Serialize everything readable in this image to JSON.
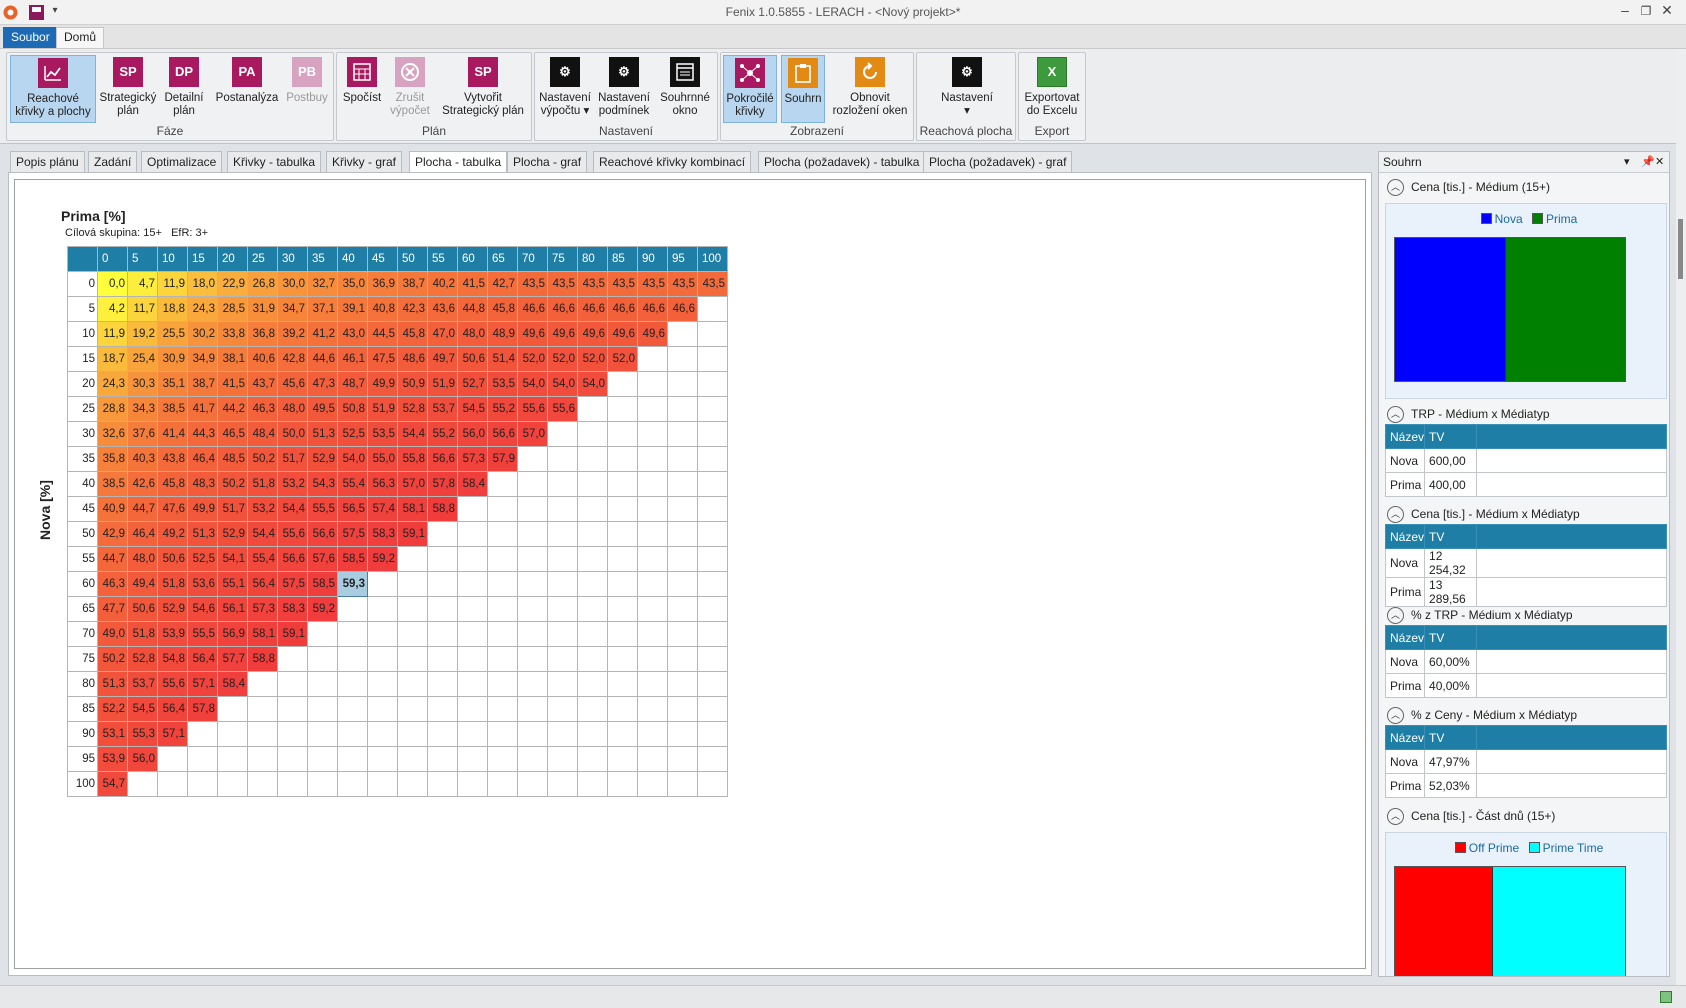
{
  "window": {
    "title": "Fenix 1.0.5855 - LERACH - <Nový projekt>*"
  },
  "menu_tabs": {
    "soubor": "Soubor",
    "domu": "Domů"
  },
  "ribbon": {
    "groups": {
      "faze": "Fáze",
      "plan": "Plán",
      "nastaveni": "Nastavení",
      "zobrazeni": "Zobrazení",
      "reachova": "Reachová plocha",
      "export": "Export"
    },
    "buttons": [
      {
        "label": "Reachové křivky a plochy",
        "icon": "chart-icon",
        "text": ""
      },
      {
        "label": "Strategický plán",
        "icon": "sp-icon",
        "text": "SP"
      },
      {
        "label": "Detailní plán",
        "icon": "dp-icon",
        "text": "DP"
      },
      {
        "label": "Postanalýza",
        "icon": "pa-icon",
        "text": "PA"
      },
      {
        "label": "Postbuy",
        "icon": "pb-icon",
        "text": "PB"
      },
      {
        "label": "Spočíst",
        "icon": "calculator-icon",
        "text": ""
      },
      {
        "label": "Zrušit výpočet",
        "icon": "cancel-icon",
        "text": ""
      },
      {
        "label": "Vytvořit Strategický plán",
        "icon": "sp-create-icon",
        "text": "SP"
      },
      {
        "label": "Nastavení výpočtu",
        "icon": "gear-icon",
        "text": ""
      },
      {
        "label": "Nastavení podmínek",
        "icon": "gear-icon",
        "text": ""
      },
      {
        "label": "Souhrnné okno",
        "icon": "window-icon",
        "text": ""
      },
      {
        "label": "Pokročilé křivky",
        "icon": "network-icon",
        "text": ""
      },
      {
        "label": "Souhrn",
        "icon": "clipboard-icon",
        "text": ""
      },
      {
        "label": "Obnovit rozložení oken",
        "icon": "refresh-icon",
        "text": ""
      },
      {
        "label": "Nastavení",
        "icon": "gear-icon",
        "text": ""
      },
      {
        "label": "Exportovat do Excelu",
        "icon": "excel-icon",
        "text": "X"
      }
    ]
  },
  "doc_tabs": [
    "Popis plánu",
    "Zadání",
    "Optimalizace",
    "Křivky - tabulka",
    "Křivky - graf",
    "Plocha - tabulka",
    "Plocha - graf",
    "Reachové křivky kombinací",
    "Plocha (požadavek) - tabulka",
    "Plocha (požadavek) - graf"
  ],
  "grid": {
    "title": "Prima [%]",
    "subtitle": "Cílová skupina: 15+   EfR: 3+",
    "ylabel": "Nova [%]",
    "columns": [
      "0",
      "5",
      "10",
      "15",
      "20",
      "25",
      "30",
      "35",
      "40",
      "45",
      "50",
      "55",
      "60",
      "65",
      "70",
      "75",
      "80",
      "85",
      "90",
      "95",
      "100"
    ],
    "rows": [
      {
        "h": "0",
        "v": [
          "0,0",
          "4,7",
          "11,9",
          "18,0",
          "22,9",
          "26,8",
          "30,0",
          "32,7",
          "35,0",
          "36,9",
          "38,7",
          "40,2",
          "41,5",
          "42,7",
          "43,5",
          "43,5",
          "43,5",
          "43,5",
          "43,5",
          "43,5",
          "43,5"
        ]
      },
      {
        "h": "5",
        "v": [
          "4,2",
          "11,7",
          "18,8",
          "24,3",
          "28,5",
          "31,9",
          "34,7",
          "37,1",
          "39,1",
          "40,8",
          "42,3",
          "43,6",
          "44,8",
          "45,8",
          "46,6",
          "46,6",
          "46,6",
          "46,6",
          "46,6",
          "46,6"
        ]
      },
      {
        "h": "10",
        "v": [
          "11,9",
          "19,2",
          "25,5",
          "30,2",
          "33,8",
          "36,8",
          "39,2",
          "41,2",
          "43,0",
          "44,5",
          "45,8",
          "47,0",
          "48,0",
          "48,9",
          "49,6",
          "49,6",
          "49,6",
          "49,6",
          "49,6"
        ]
      },
      {
        "h": "15",
        "v": [
          "18,7",
          "25,4",
          "30,9",
          "34,9",
          "38,1",
          "40,6",
          "42,8",
          "44,6",
          "46,1",
          "47,5",
          "48,6",
          "49,7",
          "50,6",
          "51,4",
          "52,0",
          "52,0",
          "52,0",
          "52,0"
        ]
      },
      {
        "h": "20",
        "v": [
          "24,3",
          "30,3",
          "35,1",
          "38,7",
          "41,5",
          "43,7",
          "45,6",
          "47,3",
          "48,7",
          "49,9",
          "50,9",
          "51,9",
          "52,7",
          "53,5",
          "54,0",
          "54,0",
          "54,0"
        ]
      },
      {
        "h": "25",
        "v": [
          "28,8",
          "34,3",
          "38,5",
          "41,7",
          "44,2",
          "46,3",
          "48,0",
          "49,5",
          "50,8",
          "51,9",
          "52,8",
          "53,7",
          "54,5",
          "55,2",
          "55,6",
          "55,6"
        ]
      },
      {
        "h": "30",
        "v": [
          "32,6",
          "37,6",
          "41,4",
          "44,3",
          "46,5",
          "48,4",
          "50,0",
          "51,3",
          "52,5",
          "53,5",
          "54,4",
          "55,2",
          "56,0",
          "56,6",
          "57,0"
        ]
      },
      {
        "h": "35",
        "v": [
          "35,8",
          "40,3",
          "43,8",
          "46,4",
          "48,5",
          "50,2",
          "51,7",
          "52,9",
          "54,0",
          "55,0",
          "55,8",
          "56,6",
          "57,3",
          "57,9"
        ]
      },
      {
        "h": "40",
        "v": [
          "38,5",
          "42,6",
          "45,8",
          "48,3",
          "50,2",
          "51,8",
          "53,2",
          "54,3",
          "55,4",
          "56,3",
          "57,0",
          "57,8",
          "58,4"
        ]
      },
      {
        "h": "45",
        "v": [
          "40,9",
          "44,7",
          "47,6",
          "49,9",
          "51,7",
          "53,2",
          "54,4",
          "55,5",
          "56,5",
          "57,4",
          "58,1",
          "58,8"
        ]
      },
      {
        "h": "50",
        "v": [
          "42,9",
          "46,4",
          "49,2",
          "51,3",
          "52,9",
          "54,4",
          "55,6",
          "56,6",
          "57,5",
          "58,3",
          "59,1"
        ]
      },
      {
        "h": "55",
        "v": [
          "44,7",
          "48,0",
          "50,6",
          "52,5",
          "54,1",
          "55,4",
          "56,6",
          "57,6",
          "58,5",
          "59,2"
        ]
      },
      {
        "h": "60",
        "v": [
          "46,3",
          "49,4",
          "51,8",
          "53,6",
          "55,1",
          "56,4",
          "57,5",
          "58,5",
          "59,3"
        ]
      },
      {
        "h": "65",
        "v": [
          "47,7",
          "50,6",
          "52,9",
          "54,6",
          "56,1",
          "57,3",
          "58,3",
          "59,2"
        ]
      },
      {
        "h": "70",
        "v": [
          "49,0",
          "51,8",
          "53,9",
          "55,5",
          "56,9",
          "58,1",
          "59,1"
        ]
      },
      {
        "h": "75",
        "v": [
          "50,2",
          "52,8",
          "54,8",
          "56,4",
          "57,7",
          "58,8"
        ]
      },
      {
        "h": "80",
        "v": [
          "51,3",
          "53,7",
          "55,6",
          "57,1",
          "58,4"
        ]
      },
      {
        "h": "85",
        "v": [
          "52,2",
          "54,5",
          "56,4",
          "57,8"
        ]
      },
      {
        "h": "90",
        "v": [
          "53,1",
          "55,3",
          "57,1"
        ]
      },
      {
        "h": "95",
        "v": [
          "53,9",
          "56,0"
        ]
      },
      {
        "h": "100",
        "v": [
          "54,7"
        ]
      }
    ],
    "selected": {
      "row": "60",
      "col": "40",
      "value": "59,3"
    }
  },
  "summary": {
    "title": "Souhrn",
    "sections": {
      "s1": {
        "title": "Cena [tis.] - Médium (15+)",
        "legend": [
          {
            "name": "Nova",
            "color": "#0000ff"
          },
          {
            "name": "Prima",
            "color": "#008000"
          }
        ],
        "values": [
          12254.32,
          13289.56
        ]
      },
      "s2": {
        "title": "TRP - Médium x Médiatyp",
        "headers": [
          "Název",
          "TV"
        ],
        "rows": [
          [
            "Nova",
            "600,00"
          ],
          [
            "Prima",
            "400,00"
          ]
        ]
      },
      "s3": {
        "title": "Cena [tis.] - Médium x Médiatyp",
        "headers": [
          "Název",
          "TV"
        ],
        "rows": [
          [
            "Nova",
            "12 254,32"
          ],
          [
            "Prima",
            "13 289,56"
          ]
        ]
      },
      "s4": {
        "title": "% z TRP - Médium x Médiatyp",
        "headers": [
          "Název",
          "TV"
        ],
        "rows": [
          [
            "Nova",
            "60,00%"
          ],
          [
            "Prima",
            "40,00%"
          ]
        ]
      },
      "s5": {
        "title": "% z Ceny - Médium x Médiatyp",
        "headers": [
          "Název",
          "TV"
        ],
        "rows": [
          [
            "Nova",
            "47,97%"
          ],
          [
            "Prima",
            "52,03%"
          ]
        ]
      },
      "s6": {
        "title": "Cena [tis.] - Část dnů (15+)",
        "legend": [
          {
            "name": "Off Prime",
            "color": "#ff0000"
          },
          {
            "name": "Prime Time",
            "color": "#00ffff"
          }
        ],
        "values": [
          42,
          58
        ]
      }
    }
  }
}
